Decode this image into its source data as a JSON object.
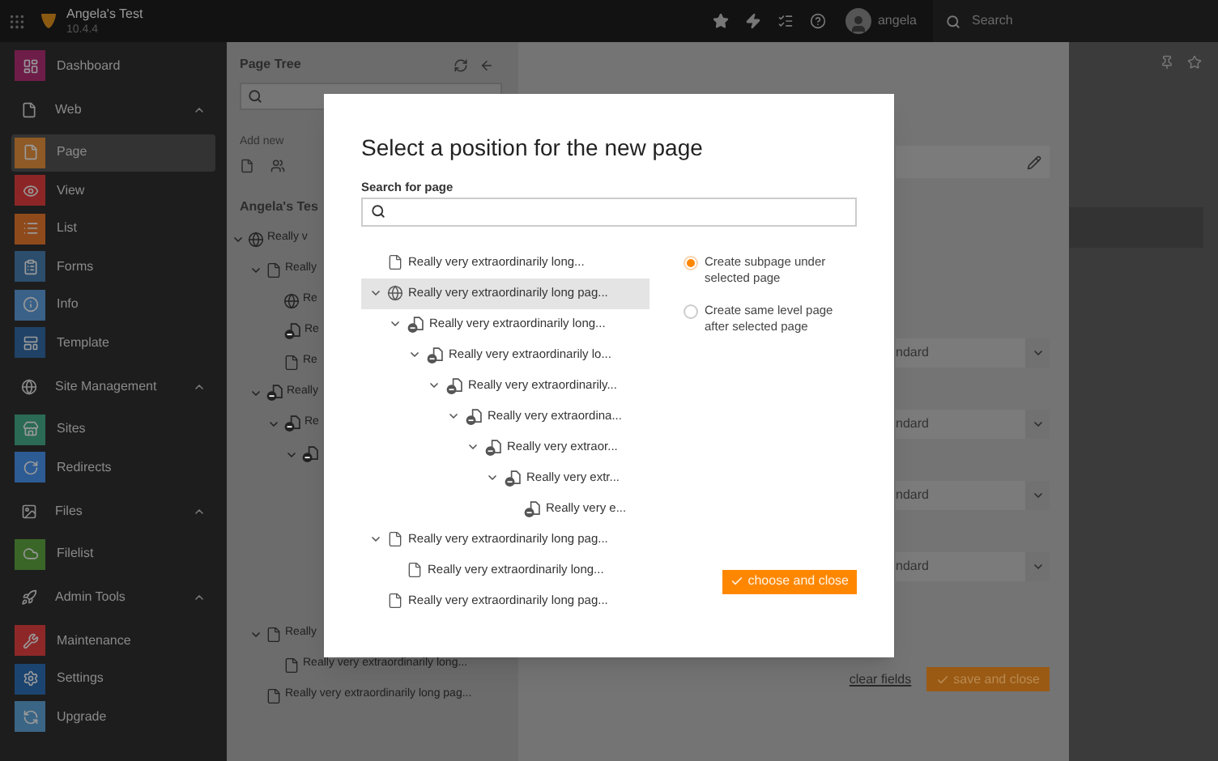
{
  "topbar": {
    "site_name": "Angela's Test",
    "version": "10.4.4",
    "user": "angela",
    "search": {
      "placeholder": "Search"
    }
  },
  "sidebar": {
    "items": [
      {
        "kind": "module",
        "label": "Dashboard",
        "color": "#6e1d49",
        "selected": false
      },
      {
        "kind": "group",
        "label": "Web",
        "expanded": true,
        "children": [
          {
            "kind": "module",
            "label": "Page",
            "color": "#8f5a26",
            "selected": true
          },
          {
            "kind": "module",
            "label": "View",
            "color": "#8c2626",
            "selected": false
          },
          {
            "kind": "module",
            "label": "List",
            "color": "#8f4a1c",
            "selected": false
          },
          {
            "kind": "module",
            "label": "Forms",
            "color": "#2c4d6c",
            "selected": false
          },
          {
            "kind": "module",
            "label": "Info",
            "color": "#3a6188",
            "selected": false
          },
          {
            "kind": "module",
            "label": "Template",
            "color": "#1f4266",
            "selected": false
          }
        ]
      },
      {
        "kind": "group",
        "label": "Site Management",
        "expanded": true,
        "children": [
          {
            "kind": "module",
            "label": "Sites",
            "color": "#2b6a55",
            "selected": false
          },
          {
            "kind": "module",
            "label": "Redirects",
            "color": "#2d5b94",
            "selected": false
          }
        ]
      },
      {
        "kind": "group",
        "label": "Files",
        "expanded": true,
        "children": [
          {
            "kind": "module",
            "label": "Filelist",
            "color": "#3a6628",
            "selected": false
          }
        ]
      },
      {
        "kind": "group",
        "label": "Admin Tools",
        "expanded": true,
        "children": [
          {
            "kind": "module",
            "label": "Maintenance",
            "color": "#8e2828",
            "selected": false
          },
          {
            "kind": "module",
            "label": "Settings",
            "color": "#1c4470",
            "selected": false
          },
          {
            "kind": "module",
            "label": "Upgrade",
            "color": "#3b6585",
            "selected": false
          }
        ]
      }
    ]
  },
  "page_tree": {
    "title": "Page Tree",
    "add_new": "Add new",
    "site": "Angela's Tes",
    "items": [
      {
        "label": "Really v",
        "kind": "globe",
        "expanded": true,
        "children": [
          {
            "label": "Really",
            "kind": "doc",
            "expanded": true,
            "children": [
              {
                "label": "Re",
                "kind": "globe"
              },
              {
                "label": "Re",
                "kind": "restricted"
              },
              {
                "label": "Re",
                "kind": "doc"
              }
            ]
          },
          {
            "label": "Really",
            "kind": "restricted",
            "expanded": true,
            "children": [
              {
                "label": "Re",
                "kind": "restricted",
                "expanded": true,
                "children": [
                  {
                    "kind": "restricted",
                    "expanded": true
                  }
                ]
              }
            ]
          },
          {
            "label": "Really",
            "kind": "doc",
            "expanded": true,
            "children": [
              {
                "label": "Really very extraordinarily long...",
                "kind": "doc"
              }
            ]
          },
          {
            "label": "Really very extraordinarily long pag...",
            "kind": "doc"
          }
        ]
      }
    ]
  },
  "content": {
    "selects": [
      {
        "value": "ndard"
      },
      {
        "value": "ndard"
      },
      {
        "value": "ndard"
      },
      {
        "value": "ndard"
      }
    ],
    "clear_link": "clear fields",
    "save_button": "save and close"
  },
  "modal": {
    "title": "Select a position for the new page",
    "search_label": "Search for page",
    "tree": [
      {
        "label": "Really very extraordinarily long...",
        "kind": "doc",
        "selected": false
      },
      {
        "label": "Really very extraordinarily long pag...",
        "kind": "globe",
        "selected": true,
        "expanded": true,
        "children": [
          {
            "label": "Really very extraordinarily long...",
            "kind": "restricted",
            "selected": false,
            "expanded": true,
            "children": [
              {
                "label": "Really very extraordinarily lo...",
                "kind": "restricted",
                "selected": false,
                "expanded": true,
                "children": [
                  {
                    "label": "Really very extraordinarily...",
                    "kind": "restricted",
                    "selected": false,
                    "expanded": true,
                    "children": [
                      {
                        "label": "Really very extraordina...",
                        "kind": "restricted",
                        "selected": false,
                        "expanded": true,
                        "children": [
                          {
                            "label": "Really very extraor...",
                            "kind": "restricted",
                            "selected": false,
                            "expanded": true,
                            "children": [
                              {
                                "label": "Really very extr...",
                                "kind": "restricted",
                                "selected": false,
                                "expanded": true,
                                "children": [
                                  {
                                    "label": "Really very e...",
                                    "kind": "restricted",
                                    "selected": false
                                  }
                                ]
                              }
                            ]
                          }
                        ]
                      }
                    ]
                  }
                ]
              }
            ]
          }
        ]
      },
      {
        "label": "Really very extraordinarily long pag...",
        "kind": "doc",
        "selected": false,
        "expanded": true,
        "children": [
          {
            "label": "Really very extraordinarily long...",
            "kind": "doc",
            "selected": false
          }
        ]
      },
      {
        "label": "Really very extraordinarily long pag...",
        "kind": "doc",
        "selected": false
      }
    ],
    "options": [
      {
        "label": "Create subpage under selected page",
        "selected": true
      },
      {
        "label": "Create same level page after selected page",
        "selected": false
      }
    ],
    "button": "choose and close"
  }
}
